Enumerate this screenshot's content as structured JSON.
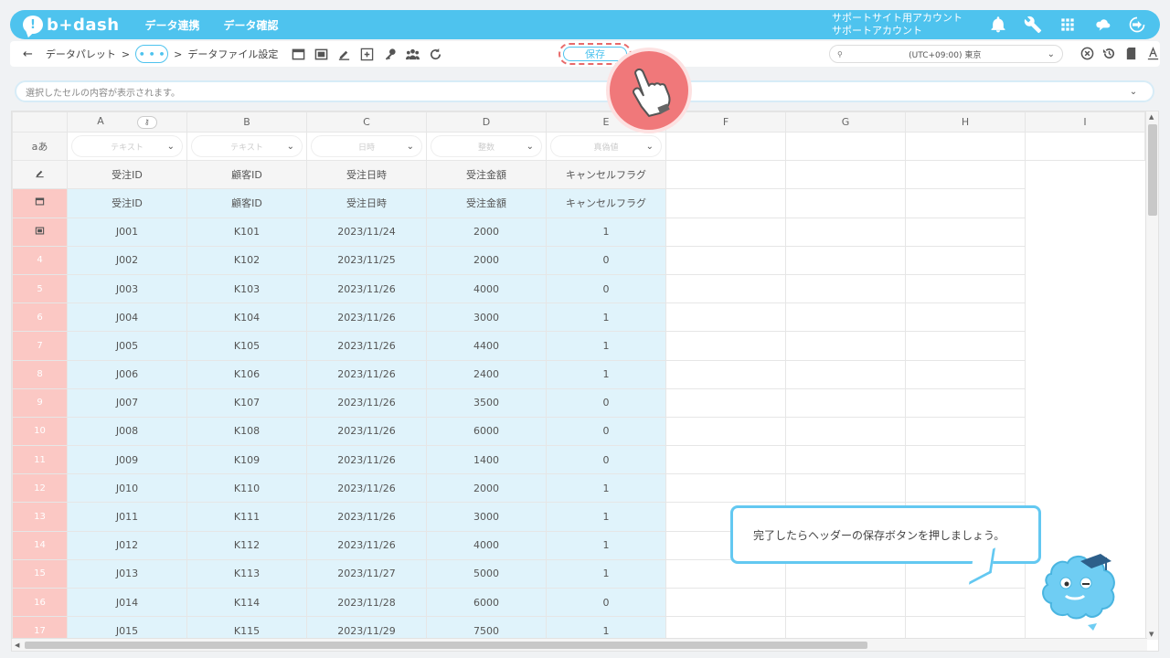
{
  "header": {
    "logo_text": "b+dash",
    "nav": [
      "データ連携",
      "データ確認"
    ],
    "account_line1": "サポートサイト用アカウント",
    "account_line2": "サポートアカウント",
    "icons": [
      "bell-icon",
      "wrench-icon",
      "grid-icon",
      "cloud-chat-icon",
      "logout-icon"
    ]
  },
  "toolbar": {
    "back": "←",
    "breadcrumb1": "データパレット",
    "sep": ">",
    "more": "• • •",
    "breadcrumb2": "データファイル設定",
    "save_label": "保存",
    "timezone": "(UTC+09:00) 東京",
    "icons": [
      "window-icon",
      "sheet-icon",
      "edit-icon",
      "add-column-icon",
      "key-icon",
      "users-icon",
      "refresh-icon"
    ],
    "right_icons": [
      "close-circle-icon",
      "history-icon",
      "file-icon",
      "text-format-icon"
    ]
  },
  "formula_bar": {
    "placeholder": "選択したセルの内容が表示されます。"
  },
  "grid": {
    "columns": [
      "A",
      "B",
      "C",
      "D",
      "E",
      "F",
      "G",
      "H",
      "I"
    ],
    "type_row_label": "aあ",
    "types": [
      "テキスト",
      "テキスト",
      "日時",
      "整数",
      "真偽値"
    ],
    "header_row": [
      "受注ID",
      "顧客ID",
      "受注日時",
      "受注金額",
      "キャンセルフラグ"
    ],
    "label_row": [
      "受注ID",
      "顧客ID",
      "受注日時",
      "受注金額",
      "キャンセルフラグ"
    ],
    "rows": [
      {
        "num": "",
        "cells": [
          "J001",
          "K101",
          "2023/11/24",
          "2000",
          "1"
        ]
      },
      {
        "num": "4",
        "cells": [
          "J002",
          "K102",
          "2023/11/25",
          "2000",
          "0"
        ]
      },
      {
        "num": "5",
        "cells": [
          "J003",
          "K103",
          "2023/11/26",
          "4000",
          "0"
        ]
      },
      {
        "num": "6",
        "cells": [
          "J004",
          "K104",
          "2023/11/26",
          "3000",
          "1"
        ]
      },
      {
        "num": "7",
        "cells": [
          "J005",
          "K105",
          "2023/11/26",
          "4400",
          "1"
        ]
      },
      {
        "num": "8",
        "cells": [
          "J006",
          "K106",
          "2023/11/26",
          "2400",
          "1"
        ]
      },
      {
        "num": "9",
        "cells": [
          "J007",
          "K107",
          "2023/11/26",
          "3500",
          "0"
        ]
      },
      {
        "num": "10",
        "cells": [
          "J008",
          "K108",
          "2023/11/26",
          "6000",
          "0"
        ]
      },
      {
        "num": "11",
        "cells": [
          "J009",
          "K109",
          "2023/11/26",
          "1400",
          "0"
        ]
      },
      {
        "num": "12",
        "cells": [
          "J010",
          "K110",
          "2023/11/26",
          "2000",
          "1"
        ]
      },
      {
        "num": "13",
        "cells": [
          "J011",
          "K111",
          "2023/11/26",
          "3000",
          "1"
        ]
      },
      {
        "num": "14",
        "cells": [
          "J012",
          "K112",
          "2023/11/26",
          "4000",
          "1"
        ]
      },
      {
        "num": "15",
        "cells": [
          "J013",
          "K113",
          "2023/11/27",
          "5000",
          "1"
        ]
      },
      {
        "num": "16",
        "cells": [
          "J014",
          "K114",
          "2023/11/28",
          "6000",
          "0"
        ]
      },
      {
        "num": "17",
        "cells": [
          "J015",
          "K115",
          "2023/11/29",
          "7500",
          "1"
        ]
      }
    ]
  },
  "tooltip": {
    "text": "完了したらヘッダーの保存ボタンを押しましょう。"
  },
  "colors": {
    "brand": "#4ec3ee",
    "highlight": "#e86a6a",
    "data_cell": "#e0f3fb",
    "row_header_red": "#fbc8c4"
  }
}
